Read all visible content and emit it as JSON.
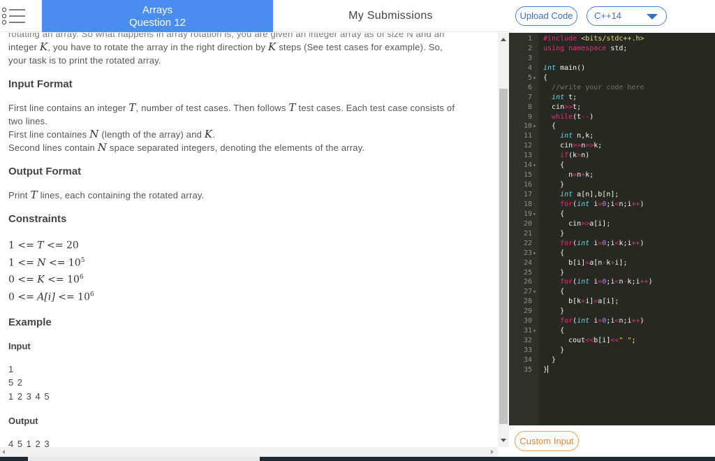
{
  "header": {
    "tab_active_line1": "Arrays",
    "tab_active_line2": "Question 12",
    "tab_submissions": "My Submissions"
  },
  "toolbar": {
    "upload_label": "Upload Code",
    "language": "C++14"
  },
  "problem": {
    "intro_cut": "rotating an array. So what happens in array rotation is, you are given an integer array as of size N and an",
    "intro_line2_a": "integer ",
    "intro_var_k": "K",
    "intro_line2_b": ", you have to rotate the array in the right direction by ",
    "intro_var_k2": "K",
    "intro_line2_c": " steps (See test cases for example). So,",
    "intro_line3": "your task is to print the rotated array.",
    "input_format_title": "Input Format",
    "input_l1_a": "First line contains an integer ",
    "input_l1_var": "T",
    "input_l1_b": ", number of test cases. Then follows ",
    "input_l1_var2": "T",
    "input_l1_c": " test cases. Each test case consists of",
    "input_l2": "two lines.",
    "input_l3_a": "First line containes ",
    "input_l3_var": "N",
    "input_l3_b": " (length of the array) and ",
    "input_l3_var2": "K",
    "input_l3_c": ".",
    "input_l4_a": "Second lines contain ",
    "input_l4_var": "N",
    "input_l4_b": " space separated integers, denoting the elements of the array.",
    "output_format_title": "Output Format",
    "output_l1_a": "Print ",
    "output_l1_var": "T",
    "output_l1_b": " lines, each containing the rotated array.",
    "constraints_title": "Constraints",
    "constraints": [
      {
        "lhs": "1 <= ",
        "v": "T",
        "rhs": " <= 20",
        "sup": ""
      },
      {
        "lhs": "1 <= ",
        "v": "N",
        "rhs": " <= 10",
        "sup": "5"
      },
      {
        "lhs": "0 <= ",
        "v": "K",
        "rhs": " <= 10",
        "sup": "6"
      },
      {
        "lhs": "0 <= ",
        "v": "A[i]",
        "rhs": " <= 10",
        "sup": "6"
      }
    ],
    "example_title": "Example",
    "input_title": "Input",
    "input_lines": [
      "1",
      "5 2",
      "1 2 3 4 5"
    ],
    "output_title": "Output",
    "output_lines": [
      "4 5 1 2 3"
    ]
  },
  "editor": {
    "lines": [
      {
        "n": "1",
        "fold": "",
        "code": "#include <bits/stdc++.h>"
      },
      {
        "n": "2",
        "fold": "",
        "code": "using namespace std;"
      },
      {
        "n": "3",
        "fold": "",
        "code": ""
      },
      {
        "n": "4",
        "fold": "",
        "code": "int main()"
      },
      {
        "n": "5",
        "fold": "▾",
        "code": "{"
      },
      {
        "n": "6",
        "fold": "",
        "code": "  //write your code here"
      },
      {
        "n": "7",
        "fold": "",
        "code": "  int t;"
      },
      {
        "n": "8",
        "fold": "",
        "code": "  cin>>t;"
      },
      {
        "n": "9",
        "fold": "",
        "code": "  while(t--)"
      },
      {
        "n": "10",
        "fold": "▾",
        "code": "  {"
      },
      {
        "n": "11",
        "fold": "",
        "code": "    int n,k;"
      },
      {
        "n": "12",
        "fold": "",
        "code": "    cin>>n>>k;"
      },
      {
        "n": "13",
        "fold": "",
        "code": "    if(k>n)"
      },
      {
        "n": "14",
        "fold": "▾",
        "code": "    {"
      },
      {
        "n": "15",
        "fold": "",
        "code": "      n=n+k;"
      },
      {
        "n": "16",
        "fold": "",
        "code": "    }"
      },
      {
        "n": "17",
        "fold": "",
        "code": "    int a[n],b[n];"
      },
      {
        "n": "18",
        "fold": "",
        "code": "    for(int i=0;i<n;i++)"
      },
      {
        "n": "19",
        "fold": "▾",
        "code": "    {"
      },
      {
        "n": "20",
        "fold": "",
        "code": "      cin>>a[i];"
      },
      {
        "n": "21",
        "fold": "",
        "code": "    }"
      },
      {
        "n": "22",
        "fold": "",
        "code": "    for(int i=0;i<k;i++)"
      },
      {
        "n": "23",
        "fold": "▾",
        "code": "    {"
      },
      {
        "n": "24",
        "fold": "",
        "code": "      b[i]=a[n-k+i];"
      },
      {
        "n": "25",
        "fold": "",
        "code": "    }"
      },
      {
        "n": "26",
        "fold": "",
        "code": "    for(int i=0;i<n-k;i++)"
      },
      {
        "n": "27",
        "fold": "▾",
        "code": "    {"
      },
      {
        "n": "28",
        "fold": "",
        "code": "      b[k+i]=a[i];"
      },
      {
        "n": "29",
        "fold": "",
        "code": "    }"
      },
      {
        "n": "30",
        "fold": "",
        "code": "    for(int i=0;i<n;i++)"
      },
      {
        "n": "31",
        "fold": "▾",
        "code": "    {"
      },
      {
        "n": "32",
        "fold": "",
        "code": "      cout<<b[i]<<\" \";"
      },
      {
        "n": "33",
        "fold": "",
        "code": "    }"
      },
      {
        "n": "34",
        "fold": "",
        "code": "  }"
      },
      {
        "n": "35",
        "fold": "",
        "code": "}"
      }
    ]
  },
  "custom_input_label": "Custom Input",
  "icons": {
    "menu": "list-menu-icon",
    "caret": "chevron-down-icon"
  },
  "colors": {
    "tab_active": "#4a8df0",
    "editor_bg": "#272822",
    "upload_border": "#4a7fd8",
    "custom_border": "#f0a050"
  }
}
